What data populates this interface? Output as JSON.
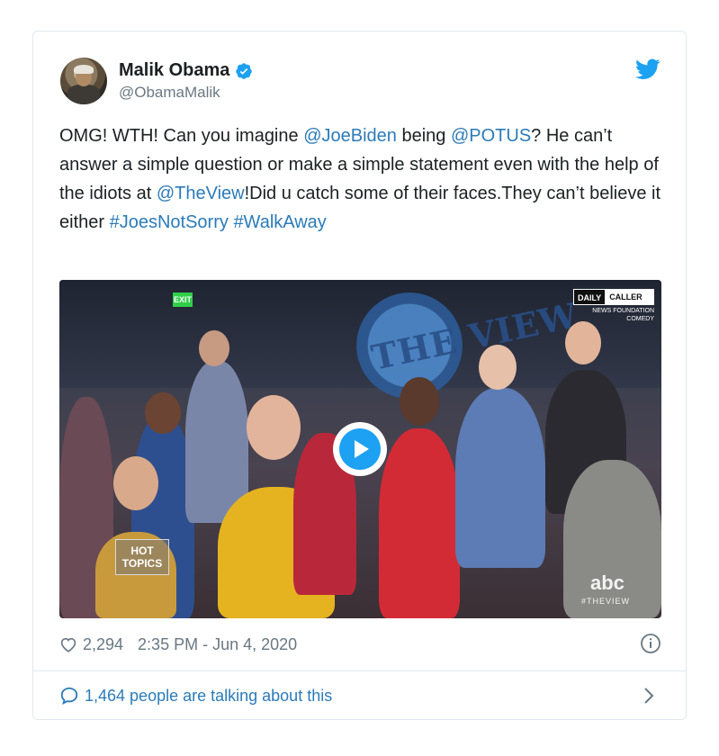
{
  "author": {
    "name": "Malik Obama",
    "handle": "@ObamaMalik"
  },
  "tweet": {
    "segments": [
      {
        "text": "OMG! WTH! Can you imagine ",
        "type": "text"
      },
      {
        "text": "@JoeBiden",
        "type": "link"
      },
      {
        "text": " being ",
        "type": "text"
      },
      {
        "text": "@POTUS",
        "type": "link"
      },
      {
        "text": "? He can’t answer a simple question or make a simple statement even with the help of the idiots at ",
        "type": "text"
      },
      {
        "text": "@TheView",
        "type": "link"
      },
      {
        "text": "!Did u catch some of their faces.They can’t believe it either ",
        "type": "text"
      },
      {
        "text": "#JoesNotSorry",
        "type": "link"
      },
      {
        "text": " ",
        "type": "text"
      },
      {
        "text": "#WalkAway",
        "type": "link"
      }
    ]
  },
  "media": {
    "overlay_top_left": "DAILY",
    "overlay_top_right": "CALLER",
    "overlay_sub1": "NEWS FOUNDATION",
    "overlay_sub2": "COMEDY",
    "show_logo": "THE VIEW",
    "lower_badge_line1": "HOT",
    "lower_badge_line2": "TOPICS",
    "network": "abc",
    "network_tag": "#THEVIEW",
    "exit_sign": "EXIT"
  },
  "meta": {
    "likes": "2,294",
    "timestamp": "2:35 PM - Jun 4, 2020"
  },
  "footer": {
    "talking": "1,464 people are talking about this"
  },
  "colors": {
    "link": "#2b7bb9",
    "twitter_blue": "#1da1f2",
    "muted": "#697882",
    "border": "#e1e8ed"
  },
  "icons": {
    "verified": "verified-badge-icon",
    "bird": "twitter-bird-icon",
    "play": "play-icon",
    "heart": "heart-icon",
    "info": "info-icon",
    "bubble": "comment-bubble-icon",
    "chevron": "chevron-right-icon"
  }
}
